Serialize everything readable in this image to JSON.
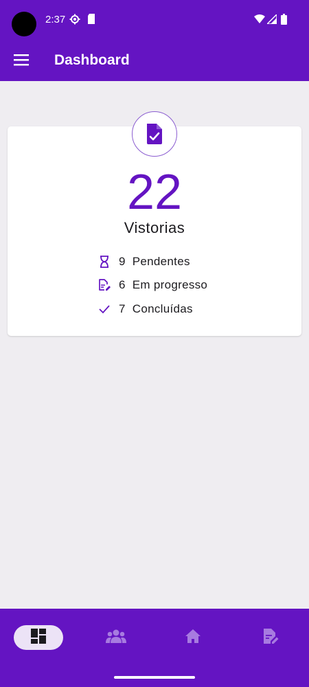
{
  "status_bar": {
    "time": "2:37",
    "icons": [
      "settings-gear-icon",
      "sd-card-icon",
      "wifi-icon",
      "signal-icon",
      "battery-icon"
    ]
  },
  "app_bar": {
    "menu_icon": "menu-icon",
    "title": "Dashboard"
  },
  "summary_card": {
    "icon": "file-check-icon",
    "total": "22",
    "label": "Vistorias",
    "stats": [
      {
        "icon": "hourglass-icon",
        "count": "9",
        "label": "Pendentes"
      },
      {
        "icon": "file-edit-icon",
        "count": "6",
        "label": "Em progresso"
      },
      {
        "icon": "check-icon",
        "count": "7",
        "label": "Concluídas"
      }
    ]
  },
  "bottom_nav": {
    "items": [
      {
        "icon": "dashboard-icon",
        "active": true
      },
      {
        "icon": "group-icon",
        "active": false
      },
      {
        "icon": "home-icon",
        "active": false
      },
      {
        "icon": "edit-document-icon",
        "active": false
      }
    ]
  },
  "colors": {
    "primary": "#6414c2",
    "background": "#efedf1",
    "card": "#ffffff",
    "nav_active_pill": "#ece3f6",
    "nav_inactive_icon": "#a77be0"
  }
}
